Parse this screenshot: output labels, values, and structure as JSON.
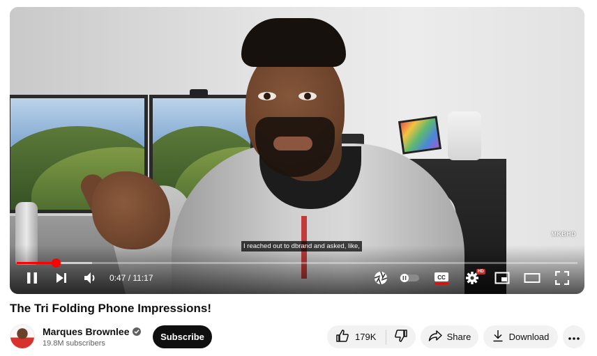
{
  "player": {
    "watermark": "MKBHD",
    "caption": "I reached out to dbrand and asked, like,",
    "progress_fraction": 0.07,
    "buffer_fraction": 0.134,
    "time_display": "0:47 / 11:17",
    "icons": {
      "play_pause": "pause-icon",
      "next": "next-icon",
      "volume": "volume-icon",
      "clip": "aperture-icon",
      "autoplay": "autoplay-toggle-icon",
      "captions": "cc-icon",
      "settings": "gear-icon",
      "miniplayer": "miniplayer-icon",
      "theater": "theater-icon",
      "fullscreen": "fullscreen-icon"
    },
    "hd_badge": "HD",
    "colors": {
      "progress": "#ff0000",
      "hd_badge": "#e62117"
    }
  },
  "video": {
    "title": "The Tri Folding Phone Impressions!"
  },
  "channel": {
    "name": "Marques Brownlee",
    "subscribers": "19.8M subscribers",
    "subscribe_label": "Subscribe"
  },
  "actions": {
    "like_count": "179K",
    "share_label": "Share",
    "download_label": "Download"
  }
}
